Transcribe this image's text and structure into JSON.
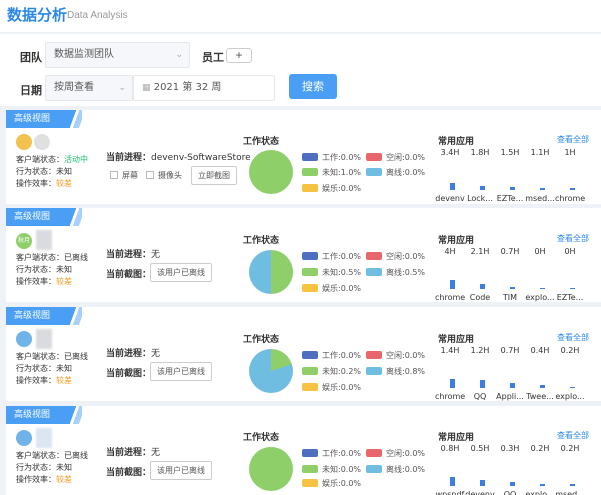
{
  "header": {
    "title": "数据分析",
    "subtitle": "Data Analysis"
  },
  "filters": {
    "team_label": "团队",
    "team_value": "数据监测团队",
    "staff_label": "员工",
    "add_label": "+",
    "date_label": "日期",
    "mode_value": "按周查看",
    "week_value": "2021 第 32 周",
    "search_label": "搜索"
  },
  "common": {
    "tag": "高级视图",
    "client_status_label": "客户端状态：",
    "behavior_label": "行为状态：",
    "efficiency_label": "操作效率：",
    "process_label": "当前进程：",
    "screenshot_label": "当前截图：",
    "work_status_title": "工作状态",
    "apps_title": "常用应用",
    "view_all": "查看全部",
    "legend": {
      "work": "工作",
      "idle": "空闲",
      "unknown": "未知",
      "offline": "离线",
      "fun": "娱乐"
    },
    "colors": {
      "work": "#4e6fbf",
      "idle": "#e8676a",
      "unknown": "#8fcf6a",
      "offline": "#6fbde0",
      "fun": "#f5c242"
    }
  },
  "cards": [
    {
      "avatar_text": "",
      "client_status": "活动中",
      "behavior": "未知",
      "efficiency": "较差",
      "process": "devenv-SoftwareStore ...",
      "screen_checkbox": "屏幕",
      "camera_checkbox": "摄像头",
      "capture_button": "立即截图",
      "legend": {
        "work": "0.0%",
        "idle": "0.0%",
        "unknown": "1.0%",
        "offline": "0.0%",
        "fun": "0.0%"
      },
      "apps": [
        {
          "hours": "3.4H",
          "name": "devenv",
          "bar": 0.55
        },
        {
          "hours": "1.8H",
          "name": "Lock...",
          "bar": 0.3
        },
        {
          "hours": "1.5H",
          "name": "EZTe...",
          "bar": 0.25
        },
        {
          "hours": "1.1H",
          "name": "msed...",
          "bar": 0.18
        },
        {
          "hours": "1H",
          "name": "chrome",
          "bar": 0.16
        }
      ]
    },
    {
      "avatar_text": "秋月",
      "client_status": "已离线",
      "behavior": "未知",
      "efficiency": "较差",
      "process": "无",
      "offline_button": "该用户已离线",
      "legend": {
        "work": "0.0%",
        "idle": "0.0%",
        "unknown": "0.5%",
        "offline": "0.5%",
        "fun": "0.0%"
      },
      "apps": [
        {
          "hours": "4H",
          "name": "chrome",
          "bar": 0.7
        },
        {
          "hours": "2.1H",
          "name": "Code",
          "bar": 0.37
        },
        {
          "hours": "0.7H",
          "name": "TIM",
          "bar": 0.12
        },
        {
          "hours": "0H",
          "name": "explo...",
          "bar": 0.02
        },
        {
          "hours": "0H",
          "name": "EZTe...",
          "bar": 0.02
        }
      ]
    },
    {
      "avatar_text": "",
      "client_status": "已离线",
      "behavior": "未知",
      "efficiency": "较差",
      "process": "无",
      "offline_button": "该用户已离线",
      "legend": {
        "work": "0.0%",
        "idle": "0.0%",
        "unknown": "0.2%",
        "offline": "0.8%",
        "fun": "0.0%"
      },
      "apps": [
        {
          "hours": "1.4H",
          "name": "chrome",
          "bar": 0.7
        },
        {
          "hours": "1.2H",
          "name": "QQ",
          "bar": 0.6
        },
        {
          "hours": "0.7H",
          "name": "Appli...",
          "bar": 0.35
        },
        {
          "hours": "0.4H",
          "name": "Twee...",
          "bar": 0.2
        },
        {
          "hours": "0.2H",
          "name": "explo...",
          "bar": 0.1
        }
      ]
    },
    {
      "avatar_text": "",
      "client_status": "已离线",
      "behavior": "未知",
      "efficiency": "较差",
      "process": "无",
      "offline_button": "该用户已离线",
      "legend": {
        "work": "0.0%",
        "idle": "0.0%",
        "unknown": "0.0%",
        "offline": "0.0%",
        "fun": "0.0%"
      },
      "apps": [
        {
          "hours": "0.8H",
          "name": "wpspdf",
          "bar": 0.7
        },
        {
          "hours": "0.5H",
          "name": "devenv",
          "bar": 0.45
        },
        {
          "hours": "0.3H",
          "name": "QQ",
          "bar": 0.27
        },
        {
          "hours": "0.2H",
          "name": "explo...",
          "bar": 0.18
        },
        {
          "hours": "0.2H",
          "name": "msed...",
          "bar": 0.18
        }
      ]
    }
  ]
}
